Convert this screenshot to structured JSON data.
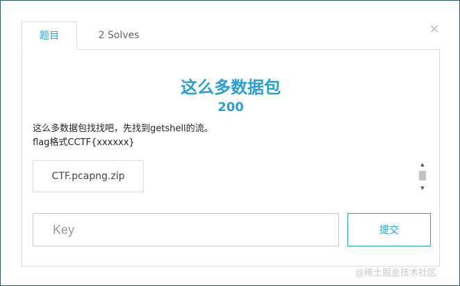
{
  "tabs": [
    {
      "label": "题目",
      "active": true
    },
    {
      "label": "2 Solves",
      "active": false
    }
  ],
  "close_icon": "×",
  "challenge": {
    "title": "这么多数据包",
    "points": "200",
    "description_lines": [
      "这么多数据包找找吧，先找到getshell的流。",
      "flag格式CCTF{xxxxxx}"
    ],
    "file_name": "CTF.pcapng.zip"
  },
  "submission": {
    "key_placeholder": "Key",
    "key_value": "",
    "submit_label": "提交"
  },
  "watermark": "@稀土掘金技术社区",
  "colors": {
    "accent": "#2a9fd6",
    "border": "#d9d9d9"
  }
}
